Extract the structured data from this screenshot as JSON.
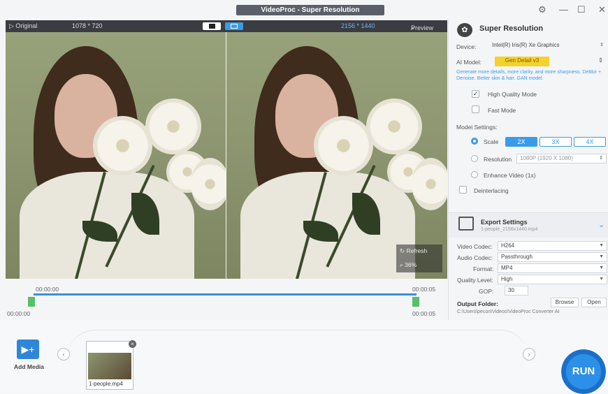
{
  "window": {
    "title": "VideoProc - Super Resolution"
  },
  "viewer": {
    "original_label": "▷ Original",
    "original_size": "1078 * 720",
    "output_size": "2156 * 1440",
    "preview_label": "Preview",
    "refresh_label": "Refresh",
    "zoom": "36%"
  },
  "timeline": {
    "start_top": "00:00:00",
    "start_bottom": "00:00:00",
    "end_top": "00:00:05",
    "end_bottom": "00:00:05"
  },
  "media": {
    "add_label": "Add Media",
    "file_name": "1-people.mp4"
  },
  "run_label": "RUN",
  "super_resolution": {
    "title": "Super Resolution",
    "device_label": "Device:",
    "device_value": "Intel(R) Iris(R) Xe Graphics",
    "ai_model_label": "AI Model:",
    "ai_model_value": "Gen Detail v3",
    "description": "Generate more details, more clarity, and more sharpness. Deblur + Denoise. Better skin & hair. GAN model.",
    "high_quality_label": "High Quality Mode",
    "fast_mode_label": "Fast Mode",
    "model_settings_label": "Model Settings:",
    "scale_label": "Scale",
    "scale_options": [
      "2X",
      "3X",
      "4X"
    ],
    "resolution_label": "Resolution",
    "resolution_value": "1080P (1920 X 1080)",
    "enhance_label": "Enhance Video (1x)",
    "deinterlacing_label": "Deinterlacing"
  },
  "export": {
    "title": "Export Settings",
    "file": "1-people_2156x1440.mp4",
    "video_codec_label": "Video Codec:",
    "video_codec": "H264",
    "audio_codec_label": "Audio Codec:",
    "audio_codec": "Passthrough",
    "format_label": "Format:",
    "format": "MP4",
    "quality_label": "Quality Level:",
    "quality": "High",
    "gop_label": "GOP:",
    "gop": "30",
    "output_folder_label": "Output Folder:",
    "browse_label": "Browse",
    "open_label": "Open",
    "output_path": "C:\\Users\\pecon\\Videos\\VideoProc Converter AI"
  },
  "colors": {
    "accent": "#3a9be8",
    "ai_model_bg": "#f5d22a",
    "run": "#2c8fe8",
    "marker": "#56c06a"
  }
}
